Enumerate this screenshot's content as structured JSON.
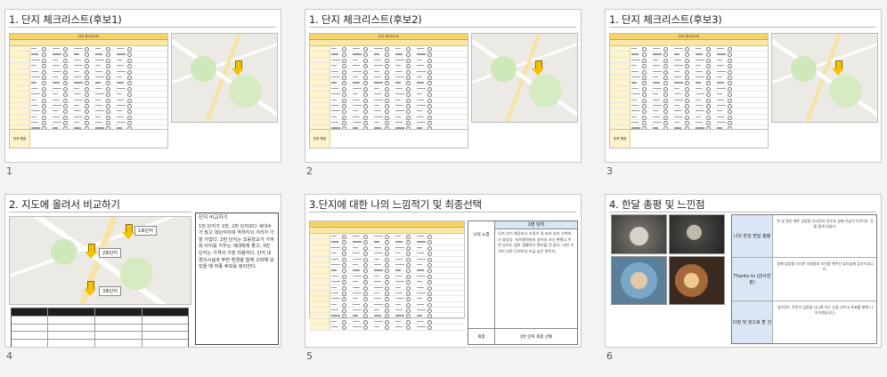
{
  "slides": [
    {
      "number": "1",
      "title": "1. 단지 체크리스트(후보1)",
      "memo_label": "단지 특징",
      "header_label": "단지 체크리스트"
    },
    {
      "number": "2",
      "title": "1. 단지 체크리스트(후보2)",
      "memo_label": "단지 특징",
      "header_label": "단지 체크리스트"
    },
    {
      "number": "3",
      "title": "1. 단지 체크리스트(후보3)",
      "memo_label": "단지 특징",
      "header_label": "단지 체크리스트"
    },
    {
      "number": "4",
      "title": "2. 지도에 올려서 비교하기"
    },
    {
      "number": "5",
      "title": "3.단지에 대한 나의 느낌적기 및 최종선택"
    },
    {
      "number": "6",
      "title": "4. 한달 총평 및 느낀점"
    }
  ],
  "slide4": {
    "map_labels": [
      "1호단지",
      "2호단지",
      "3호단지"
    ],
    "box_heading": "단지 비교하기",
    "box_text": "1번 단지가 1번, 2번 단지보다 세대수가 많고 대단지이며 역까지의 거리가 가장 가깝다. 2번 단지는 초등학교가 가까워 아이를 키우는 세대에게 좋고, 3번 단지는 가격이 가장 저렴하다. 단지 내 편의시설과 주변 환경을 함께 고려해 보았을 때 최종 후보를 정리한다."
  },
  "slide5": {
    "header": "1번 단지",
    "left_label": "나의 느낌",
    "right_text": "단지 안이 깨끗하고 조경이 잘 되어 있어 산책하기 좋았다. 지하철역까지 걸어서 가기 편했고 주변 상가도 많아 생활하기 편리할 것 같다. 다만 가격이 다른 단지보다 조금 높은 편이다.",
    "bottom_label": "최종",
    "bottom_text": "1번 단지 최종 선택"
  },
  "slide6": {
    "rows": [
      {
        "label": "나의 반성\n한달 총평",
        "text": "한 달 동안 매주 임장을 다니면서 지도와 실제 모습이 다르다는 것을 알게 되었다."
      },
      {
        "label": "Thanks to\n(감사한 분)",
        "text": "함께 임장을 다녀준 조원들과 조언을 해주신 튜터님께 감사드립니다."
      },
      {
        "label": "다짐 및\n앞으로 할 것",
        "text": "앞으로도 꾸준히 임장을 다니며 보는 눈을 키우고 목표를 향해 나아가겠습니다."
      }
    ]
  },
  "colors": {
    "table_header": "#f5d36b",
    "arrow": "#f2c200",
    "review_label": "#dbe6f4"
  }
}
